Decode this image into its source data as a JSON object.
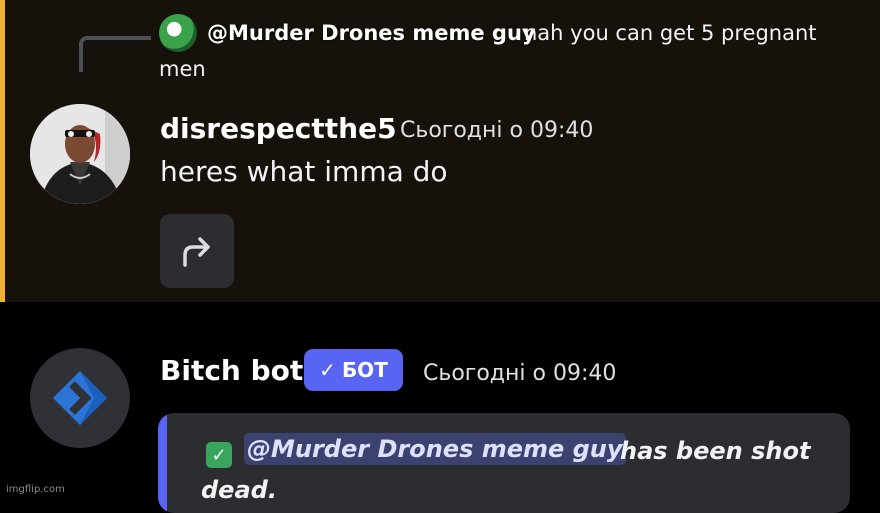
{
  "reply": {
    "mention": "@Murder Drones meme guy",
    "text_line1": "nah you can get 5 pregnant",
    "text_line2": "men"
  },
  "message1": {
    "author": "disrespectthe5",
    "timestamp": "Сьогодні о 09:40",
    "text": "heres what imma do",
    "accent_color": "#f0b232"
  },
  "message2": {
    "author": "Bitch bot",
    "badge": "БОТ",
    "timestamp": "Сьогодні о 09:40",
    "embed": {
      "mention": "@Murder Drones meme guy",
      "text_line1": "has been shot",
      "text_line2": "dead.",
      "bar_color": "#5865f2"
    }
  },
  "watermark": "imgflip.com"
}
